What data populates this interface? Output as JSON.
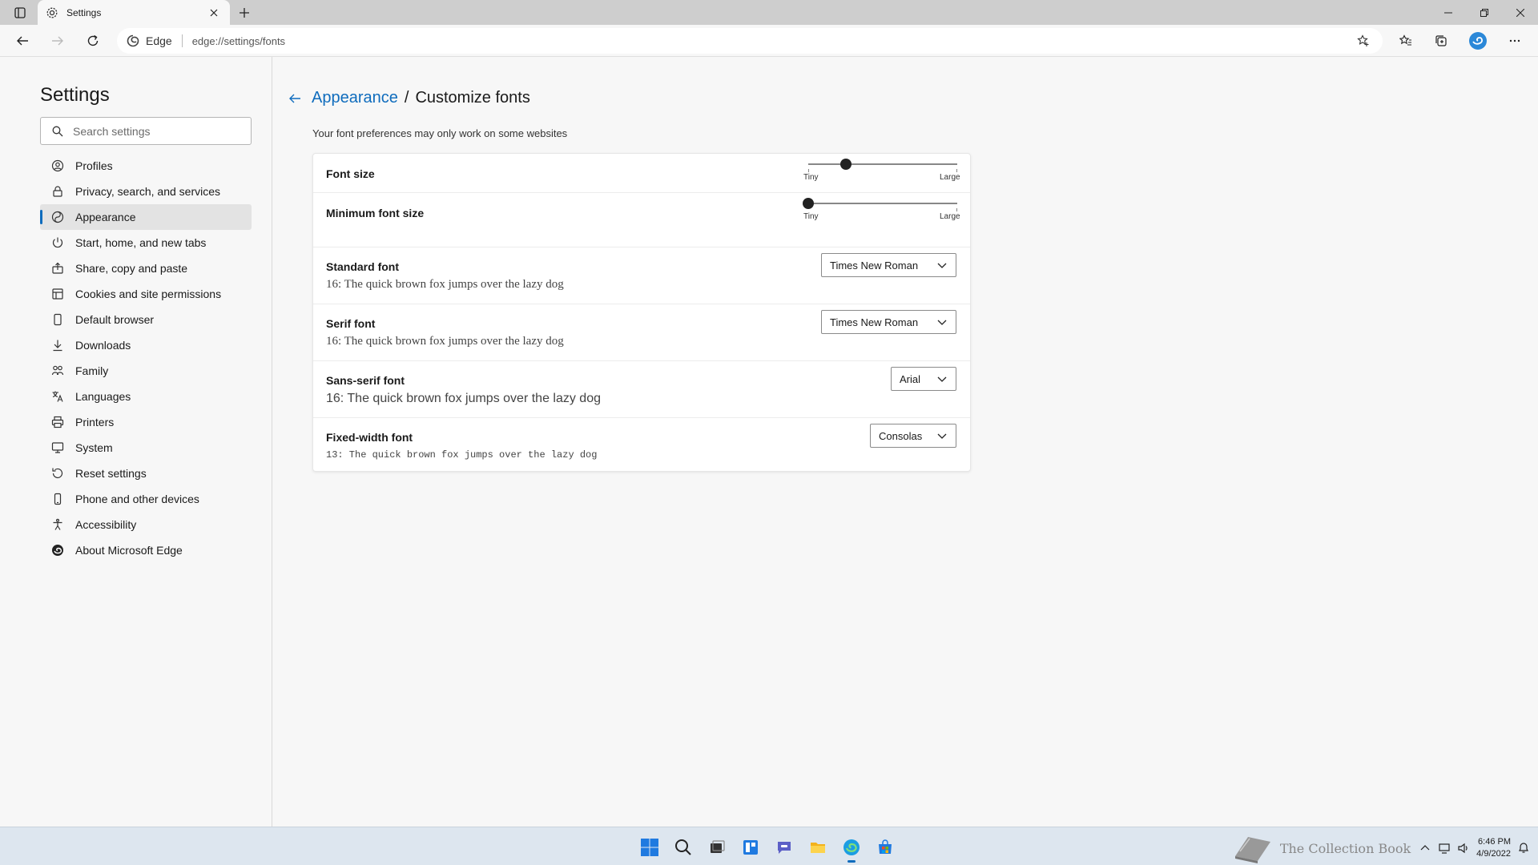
{
  "browser": {
    "tab_title": "Settings",
    "site_label": "Edge",
    "url": "edge://settings/fonts"
  },
  "sidebar": {
    "title": "Settings",
    "search_placeholder": "Search settings",
    "items": [
      {
        "label": "Profiles",
        "icon": "profile-icon"
      },
      {
        "label": "Privacy, search, and services",
        "icon": "lock-icon"
      },
      {
        "label": "Appearance",
        "icon": "appearance-icon",
        "active": true
      },
      {
        "label": "Start, home, and new tabs",
        "icon": "power-icon"
      },
      {
        "label": "Share, copy and paste",
        "icon": "share-icon"
      },
      {
        "label": "Cookies and site permissions",
        "icon": "cookies-icon"
      },
      {
        "label": "Default browser",
        "icon": "browser-icon"
      },
      {
        "label": "Downloads",
        "icon": "download-icon"
      },
      {
        "label": "Family",
        "icon": "family-icon"
      },
      {
        "label": "Languages",
        "icon": "languages-icon"
      },
      {
        "label": "Printers",
        "icon": "printer-icon"
      },
      {
        "label": "System",
        "icon": "system-icon"
      },
      {
        "label": "Reset settings",
        "icon": "reset-icon"
      },
      {
        "label": "Phone and other devices",
        "icon": "phone-icon"
      },
      {
        "label": "Accessibility",
        "icon": "accessibility-icon"
      },
      {
        "label": "About Microsoft Edge",
        "icon": "edge-icon"
      }
    ]
  },
  "main": {
    "breadcrumb_parent": "Appearance",
    "breadcrumb_separator": "/",
    "breadcrumb_current": "Customize fonts",
    "subtitle": "Your font preferences may only work on some websites",
    "font_size": {
      "label": "Font size",
      "min_label": "Tiny",
      "max_label": "Large",
      "level": 0.25
    },
    "min_font_size": {
      "label": "Minimum font size",
      "min_label": "Tiny",
      "max_label": "Large",
      "level": 0.0
    },
    "standard_font": {
      "label": "Standard font",
      "sample": "16: The quick brown fox jumps over the lazy dog",
      "value": "Times New Roman"
    },
    "serif_font": {
      "label": "Serif font",
      "sample": "16: The quick brown fox jumps over the lazy dog",
      "value": "Times New Roman"
    },
    "sans_font": {
      "label": "Sans-serif font",
      "sample": "16: The quick brown fox jumps over the lazy dog",
      "value": "Arial"
    },
    "fixed_font": {
      "label": "Fixed-width font",
      "sample": "13: The quick brown fox jumps over the lazy dog",
      "value": "Consolas"
    }
  },
  "taskbar": {
    "watermark": "The Collection Book",
    "time": "6:46 PM",
    "date": "4/9/2022"
  },
  "colors": {
    "accent": "#0f6cbd",
    "taskbar": "#dde6ef"
  }
}
